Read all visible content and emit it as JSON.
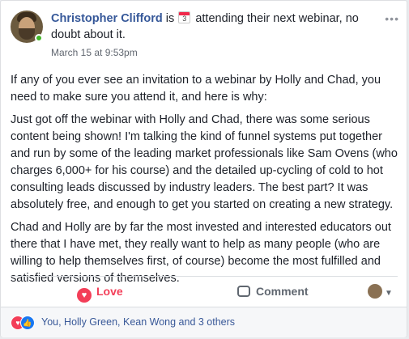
{
  "post": {
    "author": "Christopher Clifford",
    "is_word": "is",
    "calendar_day": "3",
    "status_text": "attending their next webinar, no doubt about it.",
    "timestamp": "March 15 at 9:53pm",
    "more_label": "•••",
    "paragraphs": [
      "If any of you ever see an invitation to a webinar by Holly and Chad, you need to make sure you attend it, and here is why:",
      "Just got off the webinar with Holly and Chad, there was some serious content being shown! I'm talking the kind of funnel systems put together and run by some of the leading market professionals like Sam Ovens (who charges 6,000+ for his course) and the detailed up-cycling of cold to hot consulting leads discussed by industry leaders. The best part? It was absolutely free, and enough to get you started on creating a new strategy.",
      "Chad and Holly are by far the most invested and interested educators out there that I have met, they really want to help as many people (who are willing to help themselves first, of course) become the most fulfilled and satisfied versions of themselves."
    ]
  },
  "actions": {
    "love_label": "Love",
    "comment_label": "Comment"
  },
  "reactions": {
    "summary": "You, Holly Green, Kean Wong and 3 others",
    "icons": [
      "heart-icon",
      "like-icon"
    ]
  },
  "colors": {
    "author_link": "#365899",
    "love": "#f33e58",
    "like": "#1877f2",
    "online": "#42b72a"
  }
}
